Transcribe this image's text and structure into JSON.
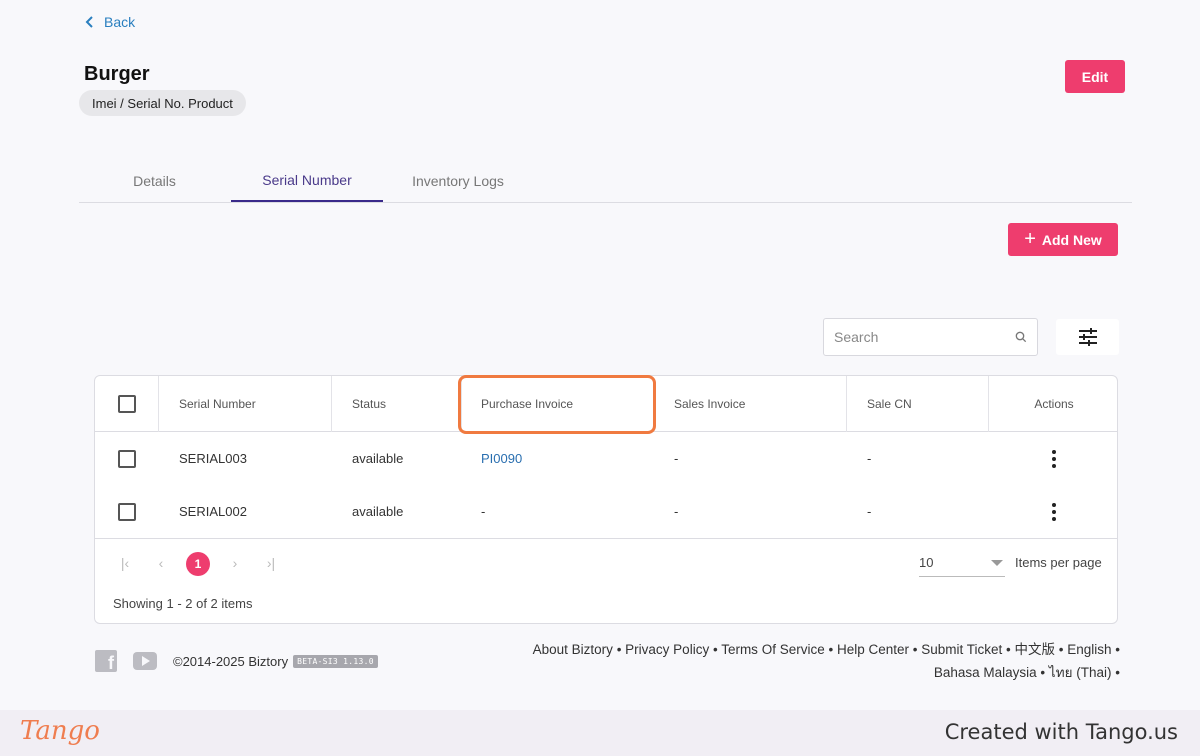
{
  "back_label": "Back",
  "product": {
    "name": "Burger",
    "type": "Imei / Serial No. Product"
  },
  "edit_label": "Edit",
  "tabs": [
    {
      "label": "Details"
    },
    {
      "label": "Serial Number"
    },
    {
      "label": "Inventory Logs"
    }
  ],
  "add_new_label": "Add New",
  "search": {
    "placeholder": "Search",
    "value": ""
  },
  "table": {
    "headers": [
      "Serial Number",
      "Status",
      "Purchase Invoice",
      "Sales Invoice",
      "Sale CN",
      "Actions"
    ],
    "rows": [
      {
        "serial": "SERIAL003",
        "status": "available",
        "purchase_invoice": "PI0090",
        "sales_invoice": "-",
        "sale_cn": "-"
      },
      {
        "serial": "SERIAL002",
        "status": "available",
        "purchase_invoice": "-",
        "sales_invoice": "-",
        "sale_cn": "-"
      }
    ]
  },
  "pagination": {
    "current_page": "1",
    "per_page": "10",
    "items_per_page_label": "Items per page",
    "showing": "Showing 1 - 2 of 2 items"
  },
  "footer": {
    "copyright": "©2014-2025 Biztory",
    "version": "BETA-SI3 1.13.0",
    "links": [
      "About Biztory",
      "Privacy Policy",
      "Terms Of Service",
      "Help Center",
      "Submit Ticket",
      "中文版",
      "English",
      "Bahasa Malaysia",
      "ไทย (Thai)"
    ]
  },
  "tango": {
    "logo": "Tango",
    "created_with": "Created with Tango.us"
  },
  "colors": {
    "accent": "#ee3d6e",
    "link": "#2a6fb0",
    "highlight": "#f07a40",
    "tab_active": "#3a2a8a"
  }
}
